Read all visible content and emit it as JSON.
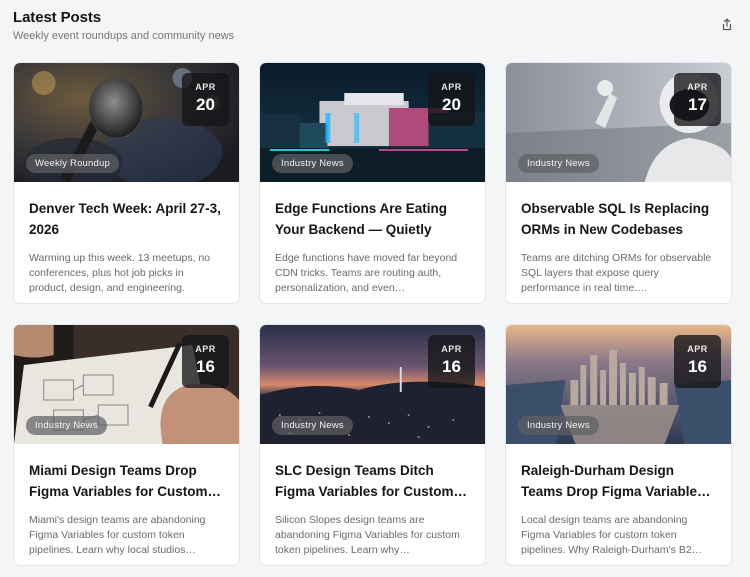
{
  "header": {
    "title": "Latest Posts",
    "subtitle": "Weekly event roundups and community news",
    "share_icon": "share-icon"
  },
  "posts": [
    {
      "month": "APR",
      "day": "20",
      "tag": "Weekly Roundup",
      "title": "Denver Tech Week: April 27-3, 2026",
      "excerpt": "Warming up this week. 13 meetups, no conferences, plus hot job picks in product, design, and engineering.",
      "image": "microphone"
    },
    {
      "month": "APR",
      "day": "20",
      "tag": "Industry News",
      "title": "Edge Functions Are Eating Your Backend — Quietly",
      "excerpt": "Edge functions have moved far beyond CDN tricks. Teams are routing auth, personalization, and even…",
      "image": "neon-building"
    },
    {
      "month": "APR",
      "day": "17",
      "tag": "Industry News",
      "title": "Observable SQL Is Replacing ORMs in New Codebases",
      "excerpt": "Teams are ditching ORMs for observable SQL layers that expose query performance in real time.…",
      "image": "robot"
    },
    {
      "month": "APR",
      "day": "16",
      "tag": "Industry News",
      "title": "Miami Design Teams Drop Figma Variables for Custom…",
      "excerpt": "Miami's design teams are abandoning Figma Variables for custom token pipelines. Learn why local studios…",
      "image": "sketching"
    },
    {
      "month": "APR",
      "day": "16",
      "tag": "Industry News",
      "title": "SLC Design Teams Ditch Figma Variables for Custom…",
      "excerpt": "Silicon Slopes design teams are abandoning Figma Variables for custom token pipelines. Learn why…",
      "image": "city-dusk"
    },
    {
      "month": "APR",
      "day": "16",
      "tag": "Industry News",
      "title": "Raleigh-Durham Design Teams Drop Figma Variable…",
      "excerpt": "Local design teams are abandoning Figma Variables for custom token pipelines. Why Raleigh-Durham's B2…",
      "image": "skyline-aerial"
    }
  ]
}
